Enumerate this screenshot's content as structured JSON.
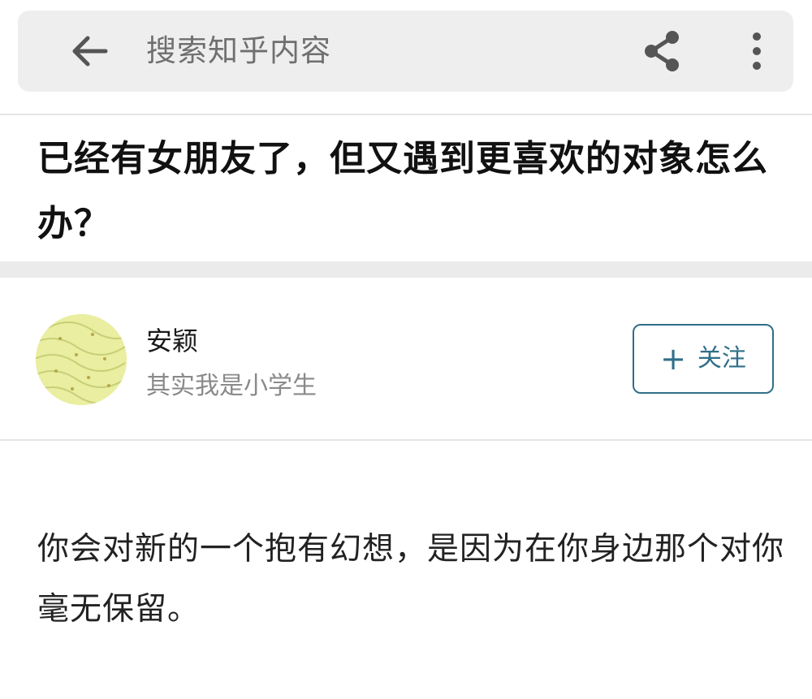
{
  "toolbar": {
    "back_icon": "arrow-left-icon",
    "search_placeholder": "搜索知乎内容",
    "share_icon": "share-icon",
    "more_icon": "more-vertical-icon"
  },
  "question": {
    "title": "已经有女朋友了，但又遇到更喜欢的对象怎么办？"
  },
  "author": {
    "name": "安颖",
    "bio": "其实我是小学生",
    "follow_plus": "+",
    "follow_label": "关注"
  },
  "answer": {
    "text": "你会对新的一个抱有幻想，是因为在你身边那个对你毫无保留。"
  },
  "colors": {
    "accent": "#2f6f89",
    "toolbar_bg": "#eeeeee",
    "avatar_bg": "#e9eea0"
  }
}
